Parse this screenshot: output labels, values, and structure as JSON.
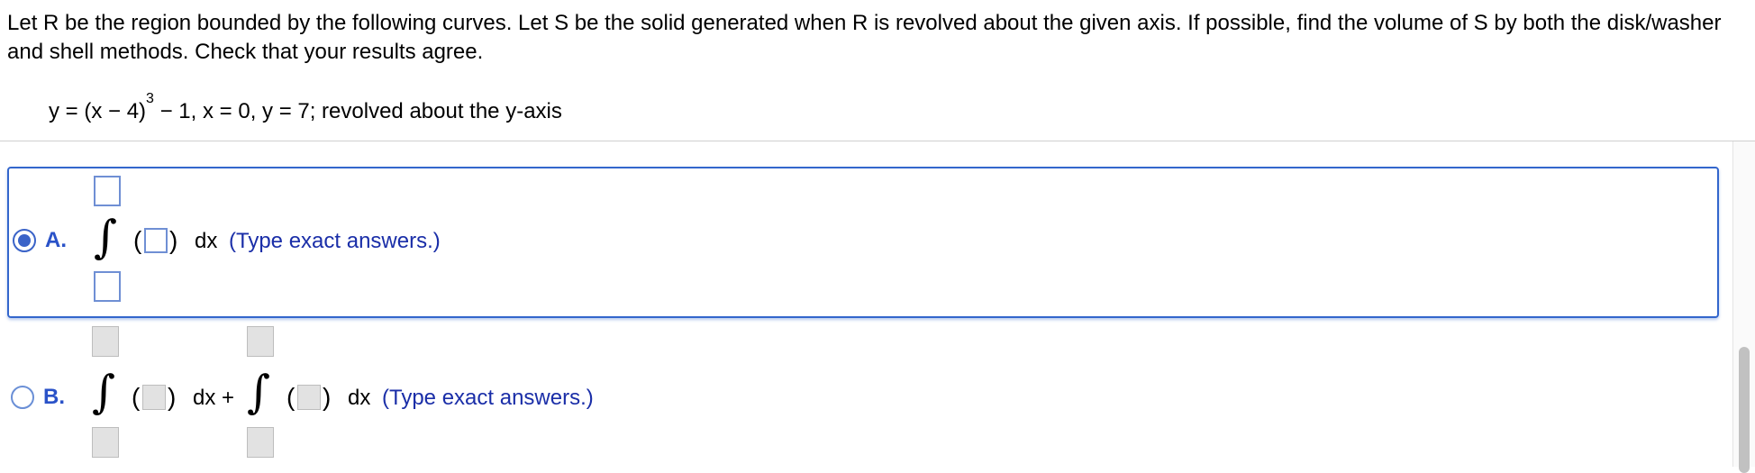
{
  "problem": {
    "text": "Let R be the region bounded by the following curves. Let S be the solid generated when R is revolved about the given axis. If possible, find the volume of S by both the disk/washer and shell methods. Check that your results agree.",
    "formula_prefix": "y = (x − 4)",
    "formula_exp": "3",
    "formula_suffix": " − 1, x = 0, y = 7; revolved about the y-axis"
  },
  "choices": [
    {
      "letter": "A.",
      "selected": true,
      "dx": "dx",
      "hint": "(Type exact answers.)"
    },
    {
      "letter": "B.",
      "selected": false,
      "dx1": "dx +",
      "dx2": "dx",
      "hint": "(Type exact answers.)"
    }
  ],
  "glyphs": {
    "integral": "∫",
    "lparen": "(",
    "rparen": ")"
  },
  "colors": {
    "accent": "#3366cc",
    "label": "#2a52c8",
    "hint_text": "#1a2ea8"
  }
}
